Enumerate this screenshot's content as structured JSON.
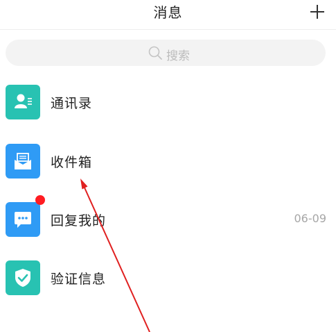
{
  "header": {
    "title": "消息",
    "add_icon": "plus-icon"
  },
  "search": {
    "placeholder": "搜索",
    "icon": "search-icon"
  },
  "list": {
    "items": [
      {
        "label": "通讯录",
        "icon": "contacts-icon",
        "color": "#28c2b2"
      },
      {
        "label": "收件箱",
        "icon": "inbox-icon",
        "color": "#2f9bf5"
      },
      {
        "label": "回复我的",
        "icon": "chat-bubble-icon",
        "color": "#2f9bf5",
        "time": "06-09",
        "badge": true
      },
      {
        "label": "验证信息",
        "icon": "shield-check-icon",
        "color": "#28c2b2"
      }
    ]
  },
  "annotation": {
    "color": "#e02020",
    "type": "arrow"
  }
}
